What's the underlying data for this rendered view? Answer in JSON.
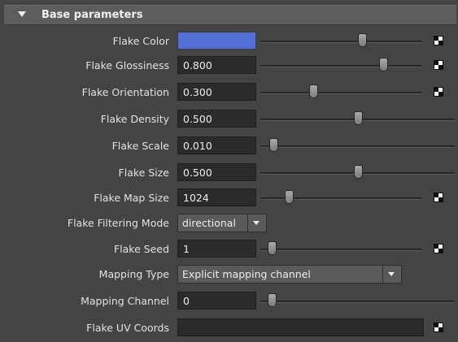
{
  "section": {
    "title": "Base parameters",
    "icon": "collapse-triangle-icon"
  },
  "colors": {
    "flake_color": "#5370d8",
    "background": "#444444",
    "field": "#2b2b2b"
  },
  "params": [
    {
      "label": "Flake Color",
      "value": "",
      "slider": 0.65,
      "map_button": true
    },
    {
      "label": "Flake Glossiness",
      "value": "0.800",
      "slider": 0.8,
      "map_button": true
    },
    {
      "label": "Flake Orientation",
      "value": "0.300",
      "slider": 0.3,
      "map_button": true
    },
    {
      "label": "Flake Density",
      "value": "0.500",
      "slider": 0.5,
      "map_button": false
    },
    {
      "label": "Flake Scale",
      "value": "0.010",
      "slider": 0.01,
      "map_button": false
    },
    {
      "label": "Flake Size",
      "value": "0.500",
      "slider": 0.5,
      "map_button": false
    },
    {
      "label": "Flake Map Size",
      "value": "1024",
      "slider": 0.12,
      "map_button": true
    },
    {
      "label": "Flake Filtering Mode",
      "value": "directional",
      "type": "dropdown"
    },
    {
      "label": "Flake Seed",
      "value": "1",
      "slider": 0.0,
      "map_button": true
    },
    {
      "label": "Mapping Type",
      "value": "Explicit mapping channel",
      "type": "dropdown"
    },
    {
      "label": "Mapping Channel",
      "value": "0",
      "slider": 0.0,
      "map_button": false
    },
    {
      "label": "Flake UV Coords",
      "value": "",
      "map_button": true
    }
  ]
}
